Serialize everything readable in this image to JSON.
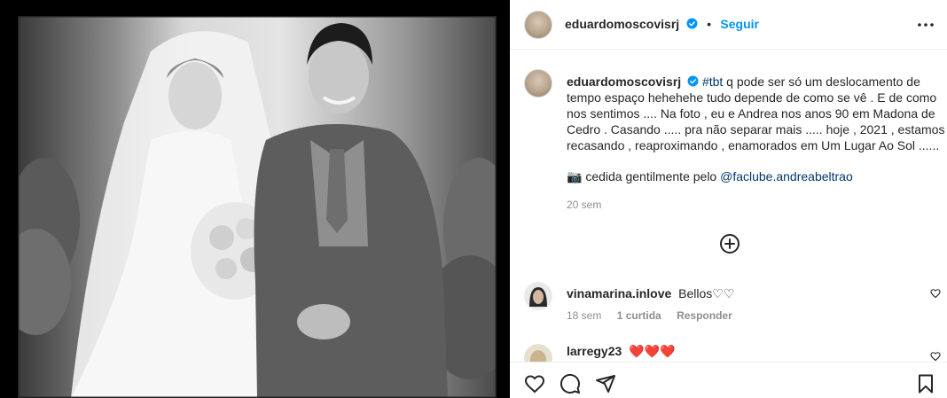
{
  "post": {
    "author": "eduardomoscovisrj",
    "follow_label": "Seguir",
    "separator": "•",
    "caption_hashtag": "#tbt",
    "caption_lines": [
      " q pode ser só um deslocamento de",
      "tempo espaço hehehehe tudo depende de como se vê . E de como",
      "nos sentimos .... Na foto , eu e Andrea nos anos 90 em Madona de",
      "Cedro . Casando ..... pra não separar mais ..... hoje , 2021 , estamos",
      "recasando , reaproximando , enamorados em Um Lugar Ao Sol ......"
    ],
    "credit_emoji": "📷",
    "credit_text": " cedida gentilmente pelo ",
    "credit_mention": "@faclube.andreabeltrao",
    "time_ago": "20 sem"
  },
  "comments": [
    {
      "username": "vinamarina.inlove",
      "text": "Bellos♡♡",
      "time": "18 sem",
      "likes": "1 curtida",
      "reply_label": "Responder"
    },
    {
      "username": "larregy23",
      "text": "❤️❤️❤️"
    }
  ],
  "icons": {
    "header_more": "more-horizontal-icon",
    "verified": "verified-badge-icon",
    "load_more": "plus-circle-icon",
    "like": "heart-icon",
    "comment": "comment-icon",
    "share": "share-icon",
    "save": "bookmark-icon"
  },
  "colors": {
    "link": "#00376b",
    "follow": "#0095f6",
    "verified": "#0095f6",
    "muted": "#8e8e8e",
    "heart_emoji": "#e0245e"
  }
}
